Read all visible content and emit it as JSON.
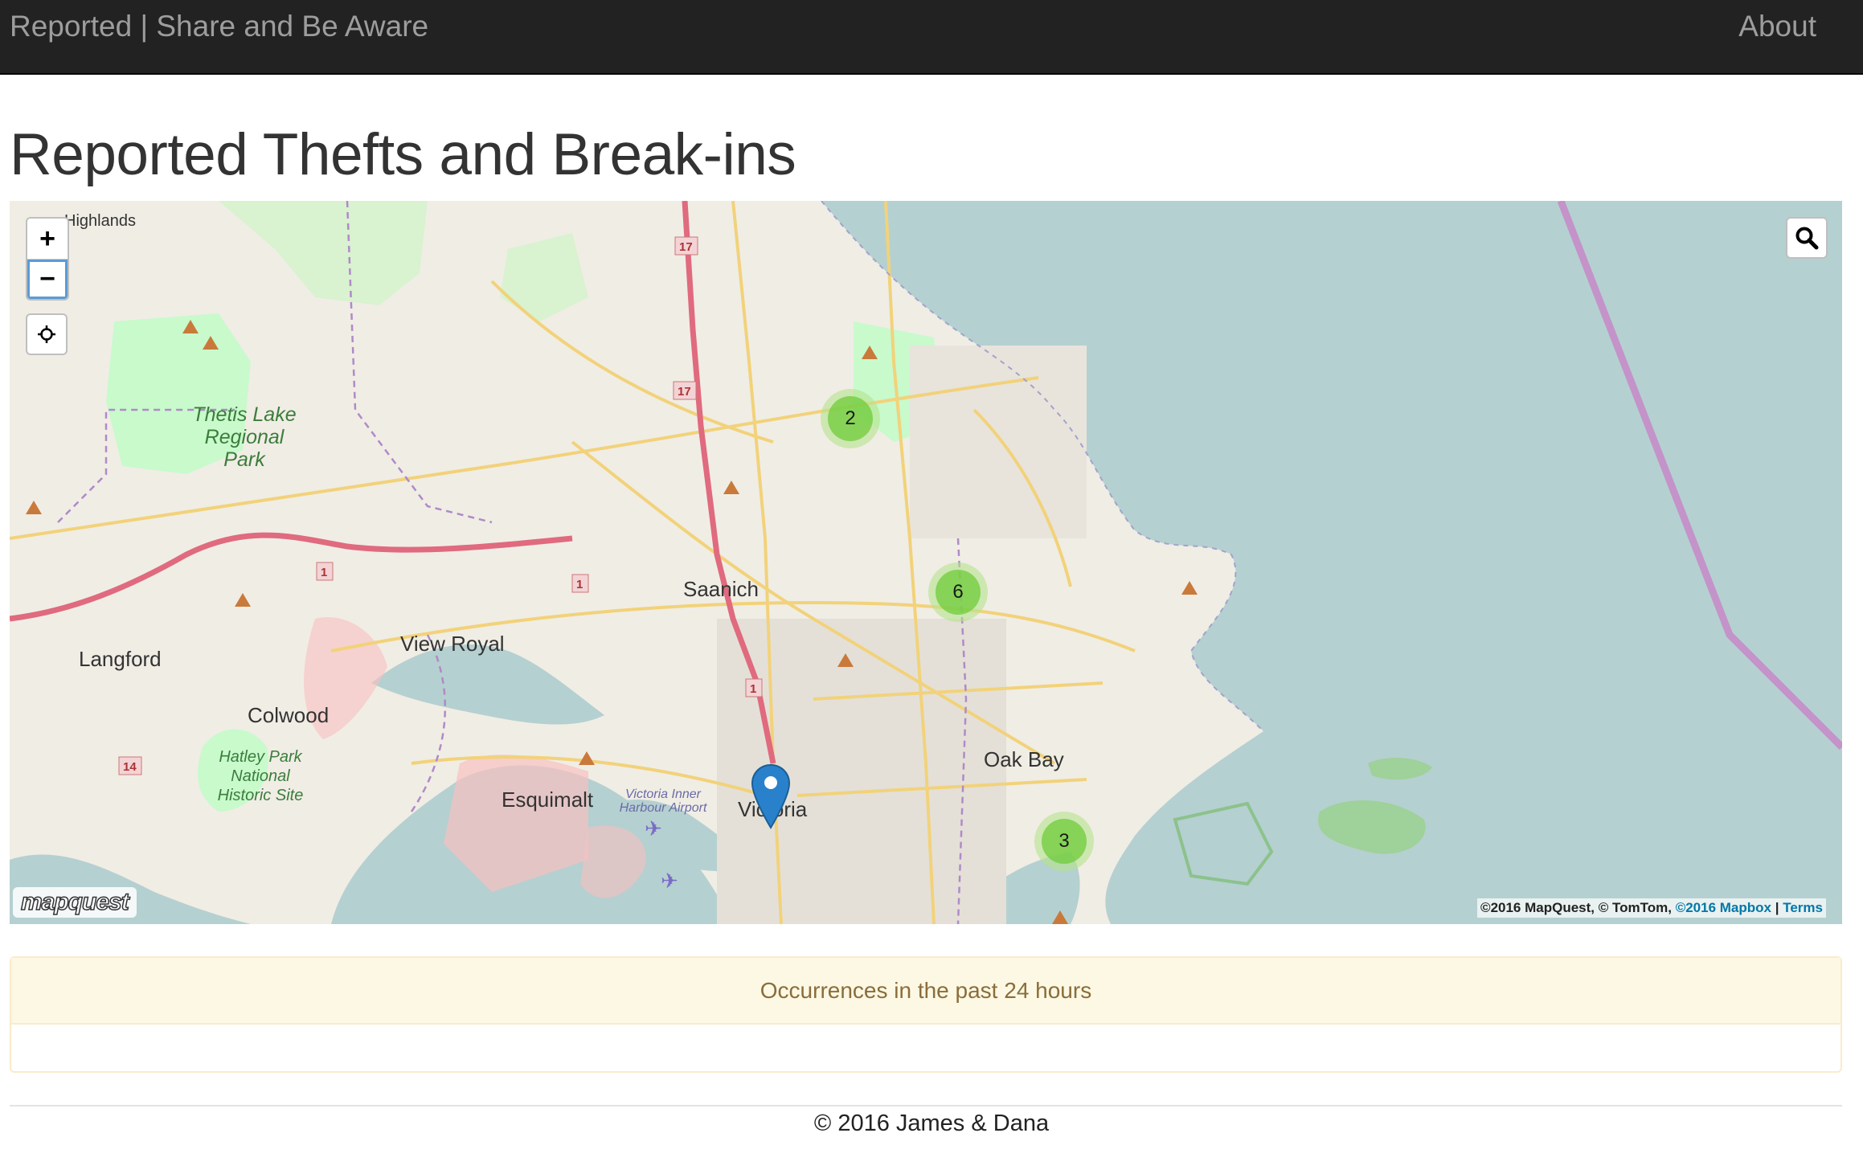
{
  "navbar": {
    "brand": "Reported | Share and Be Aware",
    "about": "About"
  },
  "page": {
    "title": "Reported Thefts and Break-ins"
  },
  "map": {
    "zoom_in": "+",
    "zoom_out": "−",
    "locate_icon": "crosshair-icon",
    "search_icon": "search-icon",
    "clusters": [
      {
        "count": "2"
      },
      {
        "count": "6"
      },
      {
        "count": "3"
      }
    ],
    "places": {
      "highlands": "Highlands",
      "saanich": "Saanich",
      "view_royal": "View Royal",
      "langford": "Langford",
      "colwood": "Colwood",
      "esquimalt": "Esquimalt",
      "victoria": "Victoria",
      "oak_bay": "Oak Bay",
      "thetis_lake": "Thetis Lake Regional Park",
      "hatley_park": "Hatley Park National Historic Site",
      "harbour_airport": "Victoria Inner Harbour Airport"
    },
    "logo": "mapquest",
    "attribution": {
      "prefix": "©2016 MapQuest, © TomTom,",
      "mapbox": "©2016 Mapbox",
      "separator": "|",
      "terms": "Terms"
    },
    "colors": {
      "water": "#b5d0d0",
      "land": "#f0ede5",
      "park": "#c8facc",
      "road_major": "#f8d98e",
      "highway": "#e892a2",
      "cluster": "#6ecc39",
      "marker": "#2a81cb"
    }
  },
  "panel": {
    "heading": "Occurrences in the past 24 hours"
  },
  "footer": {
    "text": "© 2016 James & Dana"
  }
}
